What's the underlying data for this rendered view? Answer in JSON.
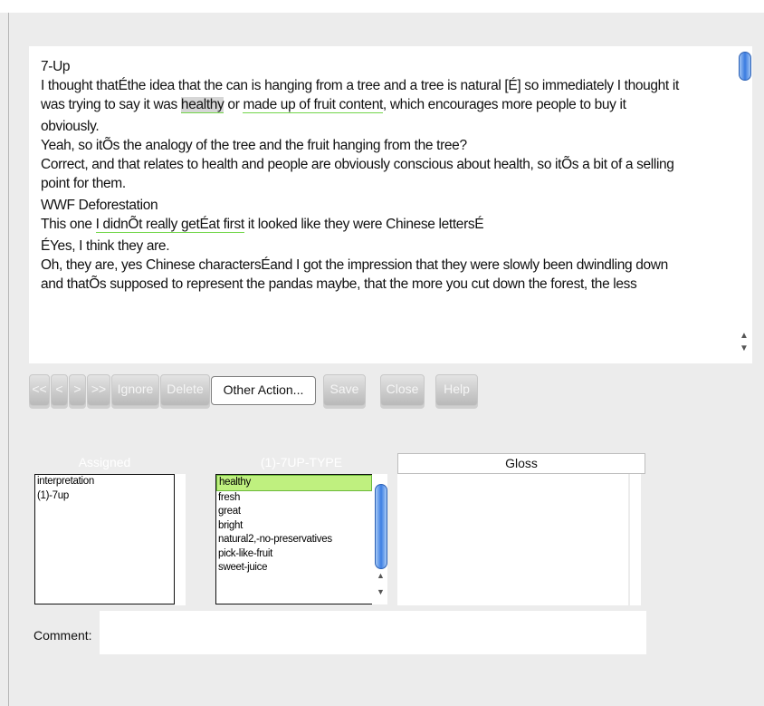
{
  "document": {
    "lines": [
      "7-Up",
      "I thought thatÉthe idea that the can is hanging from a tree and a tree is natural [É] so immediately I thought it",
      "was trying to say it was ",
      "healthy",
      " or ",
      "made up of fruit content",
      ", which encourages more people to buy it",
      "obviously.",
      "Yeah, so itÕs the analogy of the tree and the fruit hanging from the tree?",
      "Correct, and that relates to health and people are obviously conscious about health, so itÕs a bit of a selling",
      "point for them.",
      "WWF Deforestation",
      "This one ",
      "I didnÕt really getÉat first",
      " it looked like they were Chinese lettersÉ",
      "ÉYes, I think they are.",
      "Oh, they are, yes Chinese charactersÉand I got the impression that they were slowly been dwindling down",
      "and thatÕs supposed to represent the pandas maybe, that the more you cut down the forest, the less"
    ]
  },
  "toolbar": {
    "first": "<<",
    "prev": "<",
    "next": ">",
    "last": ">>",
    "ignore": "Ignore",
    "delete": "Delete",
    "other_action": "Other Action...",
    "save": "Save",
    "close": "Close",
    "help": "Help"
  },
  "assigned": {
    "title": "Assigned",
    "items": [
      "interpretation",
      "(1)-7up"
    ]
  },
  "codes": {
    "title": "(1)-7UP-TYPE",
    "items": [
      "healthy",
      "fresh",
      "great",
      "bright",
      "natural2,-no-preservatives",
      "pick-like-fruit",
      "sweet-juice"
    ],
    "selected": "healthy"
  },
  "gloss": {
    "title": "Gloss"
  },
  "comment": {
    "label": "Comment:",
    "value": ""
  }
}
